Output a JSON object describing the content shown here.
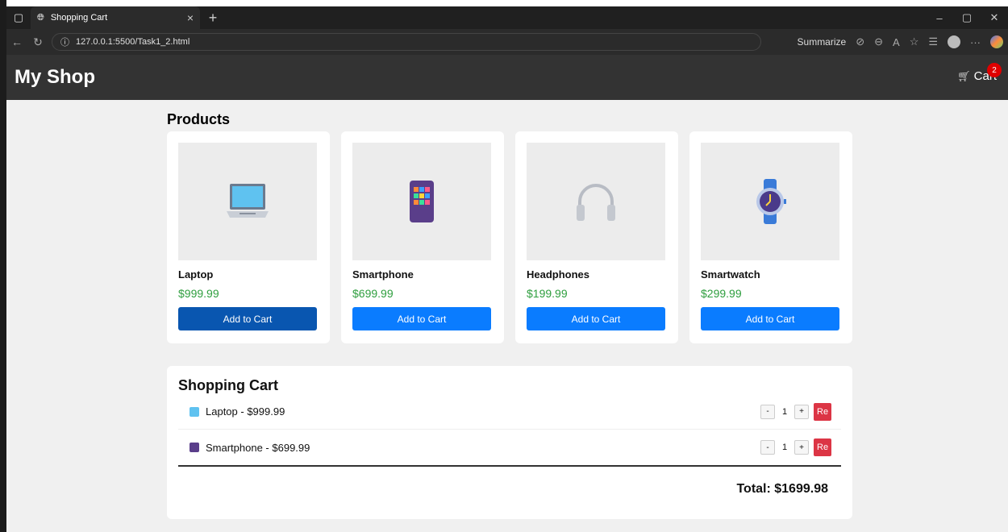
{
  "browser": {
    "tab_title": "Shopping Cart",
    "url": "127.0.0.1:5500/Task1_2.html",
    "summarize_label": "Summarize"
  },
  "header": {
    "logo": "My Shop",
    "cart_label": "Cart",
    "cart_count": "2"
  },
  "products": {
    "title": "Products",
    "button_label": "Add to Cart",
    "items": [
      {
        "name": "Laptop",
        "price": "$999.99",
        "icon": "laptop-icon"
      },
      {
        "name": "Smartphone",
        "price": "$699.99",
        "icon": "smartphone-icon"
      },
      {
        "name": "Headphones",
        "price": "$199.99",
        "icon": "headphones-icon"
      },
      {
        "name": "Smartwatch",
        "price": "$299.99",
        "icon": "smartwatch-icon"
      }
    ]
  },
  "cart": {
    "title": "Shopping Cart",
    "items": [
      {
        "label": "Laptop - $999.99",
        "qty": "1",
        "minus": "-",
        "plus": "+",
        "remove": "Re"
      },
      {
        "label": "Smartphone - $699.99",
        "qty": "1",
        "minus": "-",
        "plus": "+",
        "remove": "Re"
      }
    ],
    "total": "Total: $1699.98"
  },
  "colors": {
    "header_bg": "#333333",
    "button_blue": "#0a7cff",
    "button_blue_hover": "#0956b0",
    "price_green": "#2e9e3e",
    "remove_red": "#dc3545",
    "badge_red": "#e00000"
  }
}
